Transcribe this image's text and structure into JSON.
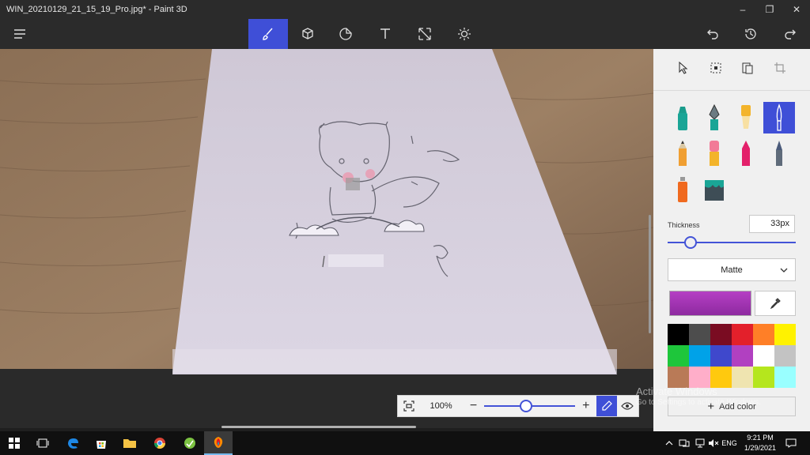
{
  "window": {
    "title": "WIN_20210129_21_15_19_Pro.jpg* - Paint 3D",
    "minimize": "–",
    "maximize": "❐",
    "close": "✕"
  },
  "toolbar": {
    "tools": [
      "menu-icon",
      "brushes-icon",
      "3d-shapes-icon",
      "stickers-icon",
      "text-icon",
      "canvas-icon",
      "effects-icon"
    ],
    "active_tool": "brushes"
  },
  "zoom": {
    "percent": "100%",
    "minus": "−",
    "plus": "+",
    "level": 0.45
  },
  "panel": {
    "thickness_label": "Thickness",
    "thickness_value": "33px",
    "thickness_level": 0.18,
    "finish": "Matte",
    "current_color": "#b53fc4",
    "swatches": [
      "#000000",
      "#4d4d4d",
      "#7a0c22",
      "#e3202b",
      "#ff7f27",
      "#fff200",
      "#1ec63b",
      "#00a2e8",
      "#3f48cc",
      "#b140c1",
      "#ffffff",
      "#c3c3c3",
      "#b97a57",
      "#ffaec9",
      "#ffc90e",
      "#efe4b0",
      "#b5e61d",
      "#99ffff"
    ],
    "add_color": "Add color"
  },
  "watermark": {
    "line1": "Activate Windows",
    "line2": "Go to Settings to activate Windows."
  },
  "taskbar": {
    "language": "ENG",
    "time": "9:21 PM",
    "date": "1/29/2021"
  },
  "colors": {
    "accent": "#3f4fd7",
    "toolbar_bg": "#2b2b2b",
    "panel_bg": "#f0f0f0"
  }
}
